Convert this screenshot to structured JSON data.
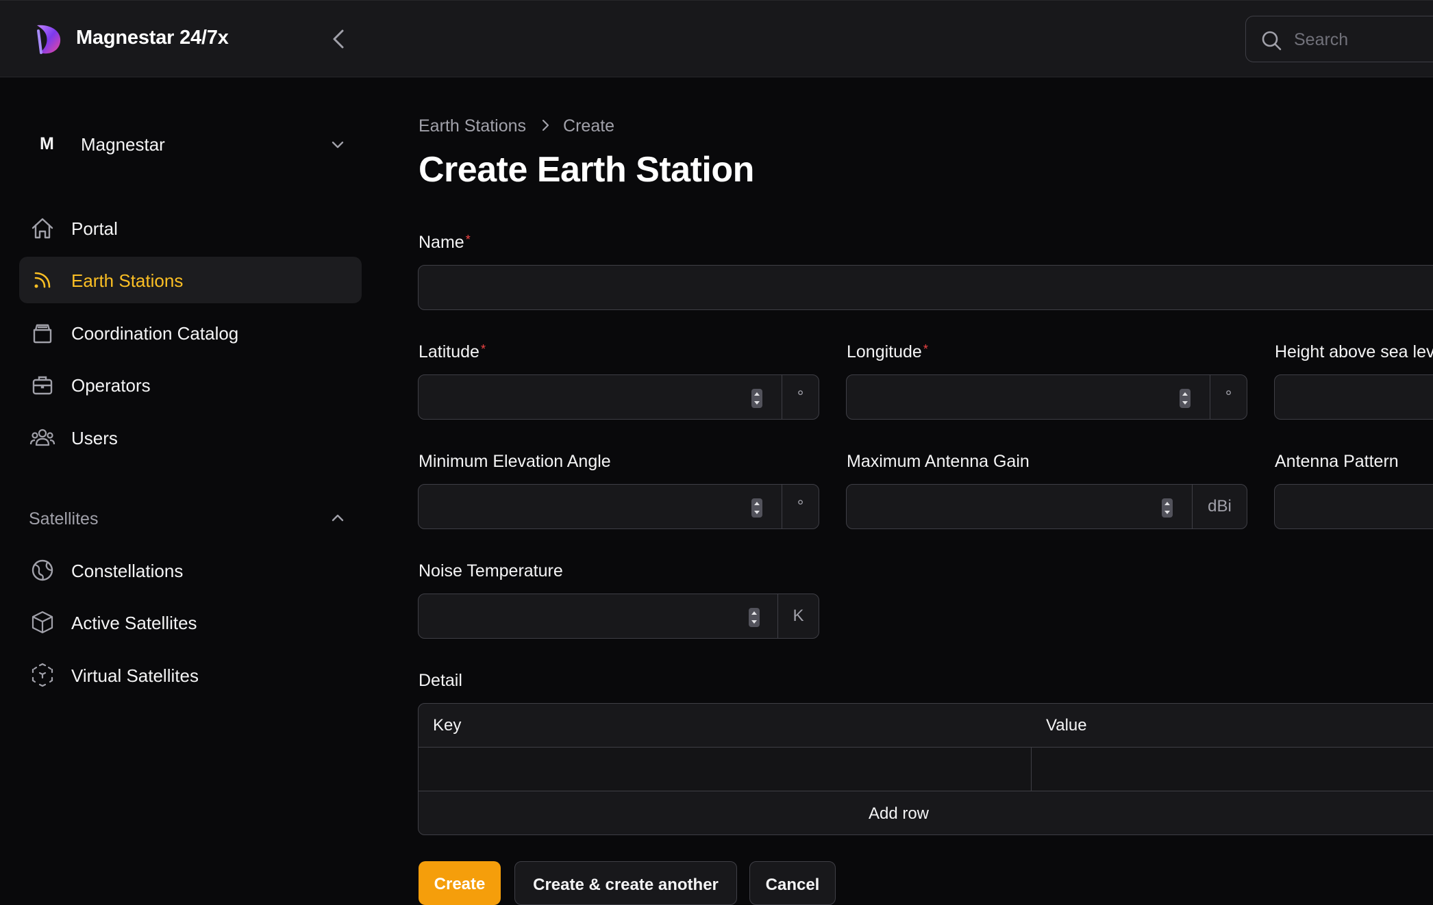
{
  "app": {
    "title": "Magnestar 24/7x"
  },
  "search": {
    "placeholder": "Search"
  },
  "tenant": {
    "initial": "M",
    "name": "Magnestar"
  },
  "sidebar": {
    "items": [
      {
        "label": "Portal",
        "icon": "home-icon"
      },
      {
        "label": "Earth Stations",
        "icon": "rss-icon",
        "active": true
      },
      {
        "label": "Coordination Catalog",
        "icon": "archive-box-icon"
      },
      {
        "label": "Operators",
        "icon": "briefcase-icon"
      },
      {
        "label": "Users",
        "icon": "user-group-icon"
      }
    ],
    "group": {
      "label": "Satellites",
      "items": [
        {
          "label": "Constellations",
          "icon": "globe-icon"
        },
        {
          "label": "Active Satellites",
          "icon": "cube-icon"
        },
        {
          "label": "Virtual Satellites",
          "icon": "cube-transparent-icon"
        }
      ]
    }
  },
  "breadcrumb": {
    "parent": "Earth Stations",
    "current": "Create"
  },
  "page": {
    "title": "Create Earth Station"
  },
  "form": {
    "name": {
      "label": "Name",
      "required_mark": "*",
      "value": ""
    },
    "latitude": {
      "label": "Latitude",
      "required_mark": "*",
      "value": "",
      "suffix": "°"
    },
    "longitude": {
      "label": "Longitude",
      "required_mark": "*",
      "value": "",
      "suffix": "°"
    },
    "height": {
      "label": "Height above sea level",
      "value": ""
    },
    "min_elevation": {
      "label": "Minimum Elevation Angle",
      "value": "",
      "suffix": "°"
    },
    "max_gain": {
      "label": "Maximum Antenna Gain",
      "value": "",
      "suffix": "dBi"
    },
    "antenna_pattern": {
      "label": "Antenna Pattern",
      "value": ""
    },
    "noise_temp": {
      "label": "Noise Temperature",
      "value": "",
      "suffix": "K"
    },
    "detail": {
      "label": "Detail",
      "key_header": "Key",
      "value_header": "Value",
      "add_row": "Add row"
    }
  },
  "actions": {
    "create": "Create",
    "create_another": "Create & create another",
    "cancel": "Cancel"
  },
  "colors": {
    "accent": "#f59e0b",
    "active_nav": "#fbbf24",
    "required": "#ef4444",
    "background": "#09090b"
  }
}
